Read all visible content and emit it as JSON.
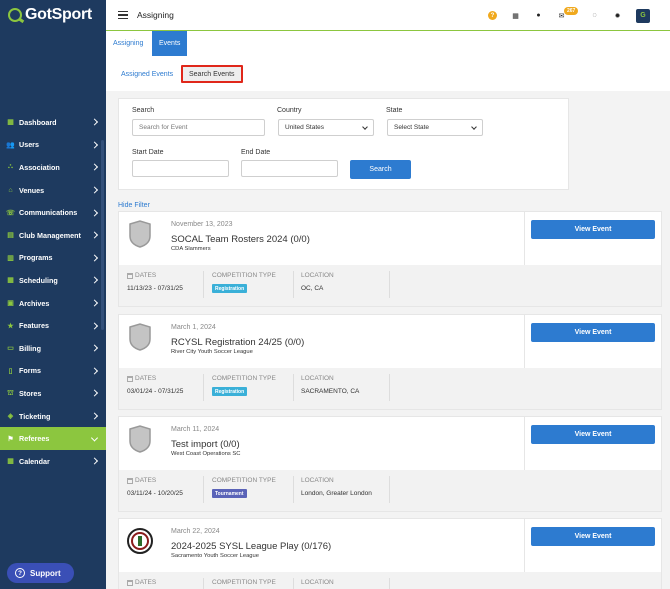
{
  "app": {
    "logo_text": "GotSport",
    "page_title": "Assigning",
    "notifications_count": "267",
    "avatar_initial": "G"
  },
  "sidebar": {
    "items": [
      {
        "label": "Dashboard",
        "icon": "dashboard-icon",
        "glyph": "▦",
        "active": false
      },
      {
        "label": "Users",
        "icon": "users-icon",
        "glyph": "👥",
        "active": false
      },
      {
        "label": "Association",
        "icon": "association-icon",
        "glyph": "⛬",
        "active": false
      },
      {
        "label": "Venues",
        "icon": "venues-icon",
        "glyph": "⌂",
        "active": false
      },
      {
        "label": "Communications",
        "icon": "communications-icon",
        "glyph": "☏",
        "active": false
      },
      {
        "label": "Club Management",
        "icon": "club-management-icon",
        "glyph": "▤",
        "active": false
      },
      {
        "label": "Programs",
        "icon": "programs-icon",
        "glyph": "▥",
        "active": false
      },
      {
        "label": "Scheduling",
        "icon": "scheduling-icon",
        "glyph": "▦",
        "active": false
      },
      {
        "label": "Archives",
        "icon": "archives-icon",
        "glyph": "▣",
        "active": false
      },
      {
        "label": "Features",
        "icon": "features-icon",
        "glyph": "★",
        "active": false
      },
      {
        "label": "Billing",
        "icon": "billing-icon",
        "glyph": "▭",
        "active": false
      },
      {
        "label": "Forms",
        "icon": "forms-icon",
        "glyph": "▯",
        "active": false
      },
      {
        "label": "Stores",
        "icon": "stores-icon",
        "glyph": "⛫",
        "active": false
      },
      {
        "label": "Ticketing",
        "icon": "ticketing-icon",
        "glyph": "◈",
        "active": false
      },
      {
        "label": "Referees",
        "icon": "referees-icon",
        "glyph": "⚑",
        "active": true
      },
      {
        "label": "Calendar",
        "icon": "calendar-icon",
        "glyph": "▦",
        "active": false
      }
    ],
    "support_label": "Support"
  },
  "tabs": {
    "top": [
      "Assigning",
      "Events"
    ],
    "sub": [
      "Assigned Events",
      "Search Events"
    ]
  },
  "filter": {
    "search_label": "Search",
    "search_placeholder": "Search for Event",
    "country_label": "Country",
    "country_value": "United States",
    "state_label": "State",
    "state_value": "Select State",
    "start_date_label": "Start Date",
    "end_date_label": "End Date",
    "search_button": "Search",
    "hide_filter": "Hide Filter"
  },
  "meta_labels": {
    "dates": "DATES",
    "competition_type": "COMPETITION TYPE",
    "location": "LOCATION"
  },
  "view_button_label": "View Event",
  "events": [
    {
      "date": "November 13, 2023",
      "title": "SOCAL Team Rosters 2024 (0/0)",
      "org": "CDA Slammers",
      "dates": "11/13/23 - 07/31/25",
      "competition_type": "Registration",
      "location": "OC, CA"
    },
    {
      "date": "March 1, 2024",
      "title": "RCYSL Registration 24/25 (0/0)",
      "org": "River City Youth Soccer League",
      "dates": "03/01/24 - 07/31/25",
      "competition_type": "Registration",
      "location": "SACRAMENTO, CA"
    },
    {
      "date": "March 11, 2024",
      "title": "Test import (0/0)",
      "org": "West Coast Operations SC",
      "dates": "03/11/24 - 10/20/25",
      "competition_type": "Tournament",
      "location": "London, Greater London"
    },
    {
      "date": "March 22, 2024",
      "title": "2024-2025 SYSL League Play (0/176)",
      "org": "Sacramento Youth Soccer League",
      "dates": "",
      "competition_type": "",
      "location": ""
    }
  ],
  "colors": {
    "sidebar_bg": "#1e3a5f",
    "accent_green": "#8cc63f",
    "primary_blue": "#2d7bd0",
    "registration_pill": "#3ab0d8",
    "tournament_pill": "#5a63b8",
    "highlight_red": "#e0271a"
  }
}
